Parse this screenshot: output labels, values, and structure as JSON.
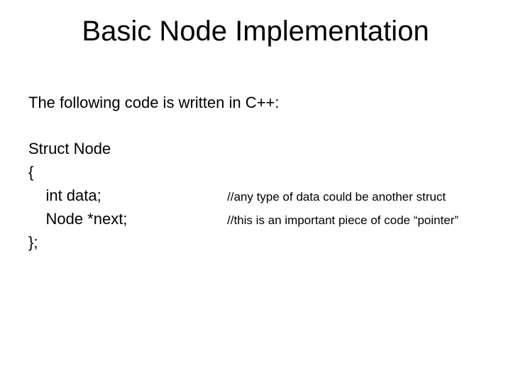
{
  "title": "Basic Node Implementation",
  "intro": "The following code is written in C++:",
  "code": {
    "line1": "Struct Node",
    "line2": "{",
    "line3_code": "    int data;",
    "line3_comment": "//any type of data could be another struct",
    "line4_code": "    Node *next;",
    "line4_comment": "//this is an important piece of code “pointer”",
    "line5": "};"
  }
}
